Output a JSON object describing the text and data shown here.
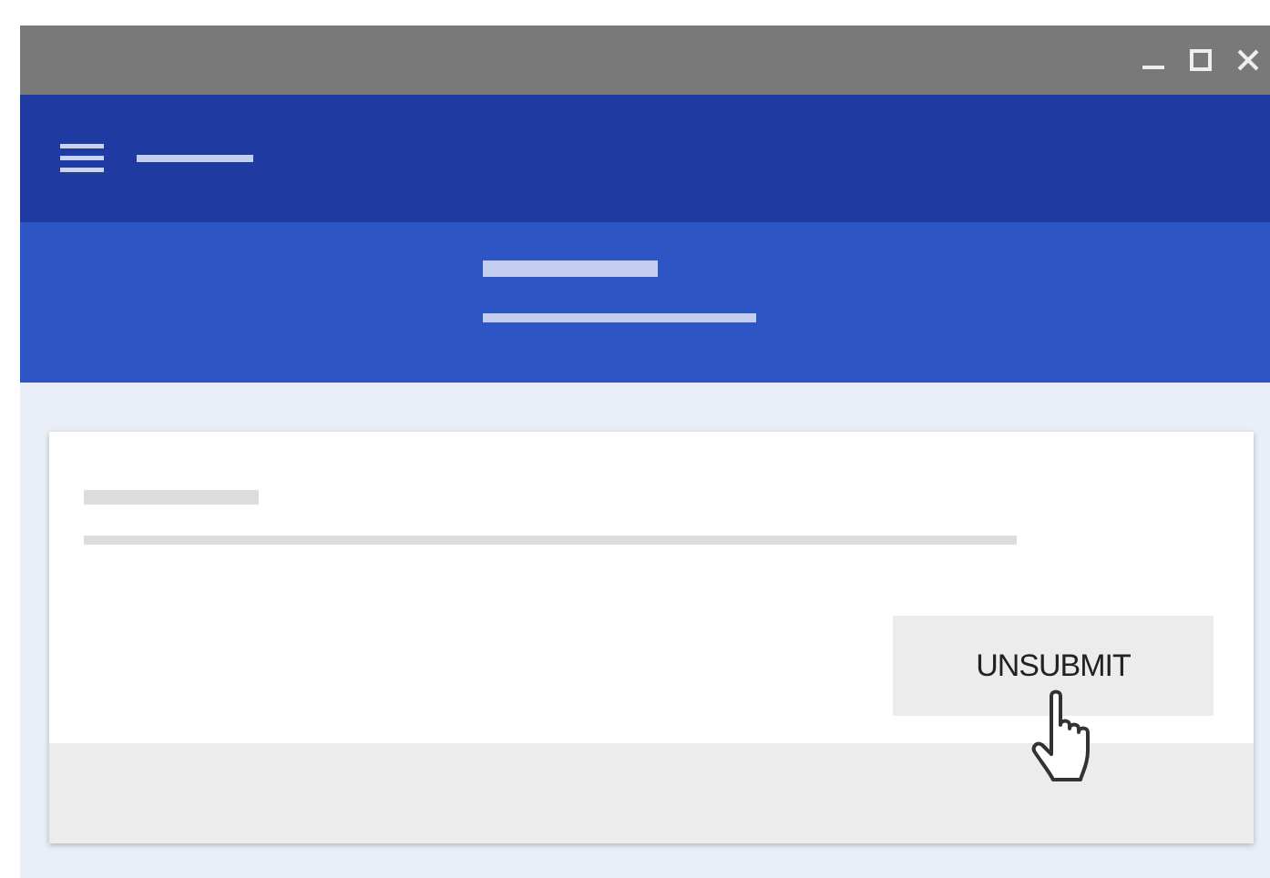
{
  "card": {
    "button": {
      "label": "UNSUBMIT"
    }
  }
}
